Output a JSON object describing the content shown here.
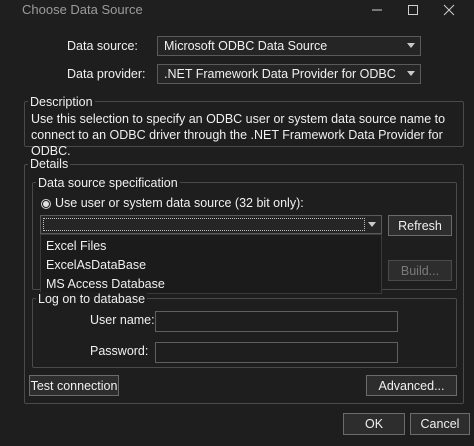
{
  "window": {
    "title": "Choose Data Source"
  },
  "main": {
    "data_source_label": "Data source:",
    "data_source_value": "Microsoft ODBC Data Source",
    "data_provider_label": "Data provider:",
    "data_provider_value": ".NET Framework Data Provider for ODBC"
  },
  "description": {
    "title": "Description",
    "text": "Use this selection to specify an ODBC user or system data source name to connect to an ODBC driver through the .NET Framework Data Provider for ODBC."
  },
  "details": {
    "title": "Details",
    "spec_title": "Data source specification",
    "radio_label": "Use user or system data source (32 bit only):",
    "refresh_label": "Refresh",
    "build_label": "Build...",
    "dropdown_items": [
      "Excel Files",
      "ExcelAsDataBase",
      "MS Access Database"
    ],
    "logon_title": "Log on to database",
    "username_label": "User name:",
    "password_label": "Password:"
  },
  "footer": {
    "test_connection_label": "Test connection",
    "advanced_label": "Advanced...",
    "ok_label": "OK",
    "cancel_label": "Cancel"
  }
}
